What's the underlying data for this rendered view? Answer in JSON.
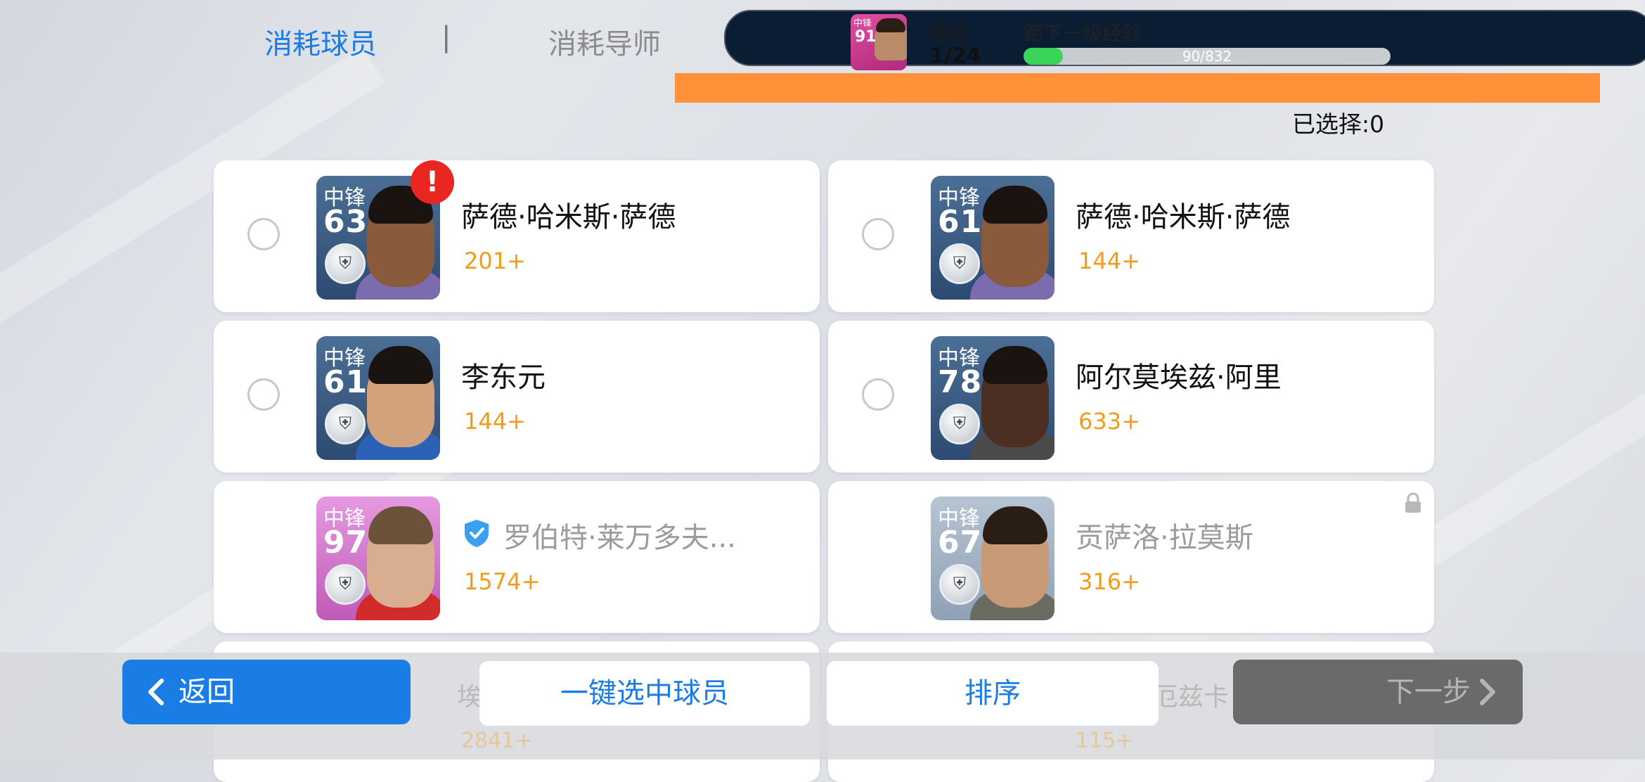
{
  "tabs": {
    "active": "消耗球员",
    "separator": "|",
    "inactive": "消耗导师"
  },
  "level_panel": {
    "card_position": "中锋",
    "card_rating": "91",
    "level_label": "等级",
    "level_value": "1/24",
    "exp_label": "距下一级经验",
    "exp_text": "90/832",
    "exp_progress": 0.108
  },
  "selected_count": "已选择:0",
  "players": [
    {
      "position": "中锋",
      "rating": "63",
      "name": "萨德·哈米斯·萨德",
      "exp": "201+",
      "style": "blue",
      "alert": "!",
      "skin": "#8a5a3c",
      "hair": "#1b1310",
      "shirt": "#7d6bb0",
      "dimmed": false,
      "selectable": true
    },
    {
      "position": "中锋",
      "rating": "61",
      "name": "萨德·哈米斯·萨德",
      "exp": "144+",
      "style": "blue",
      "alert": "",
      "skin": "#8a5a3c",
      "hair": "#1b1310",
      "shirt": "#7d6bb0",
      "dimmed": false,
      "selectable": true
    },
    {
      "position": "中锋",
      "rating": "61",
      "name": "李东元",
      "exp": "144+",
      "style": "blue",
      "alert": "",
      "skin": "#d2a27c",
      "hair": "#1a1410",
      "shirt": "#2b62b8",
      "dimmed": false,
      "selectable": true
    },
    {
      "position": "中锋",
      "rating": "78",
      "name": "阿尔莫埃兹·阿里",
      "exp": "633+",
      "style": "blue",
      "alert": "",
      "skin": "#4a2f22",
      "hair": "#1a1310",
      "shirt": "#4a4a4a",
      "dimmed": false,
      "selectable": true
    },
    {
      "position": "中锋",
      "rating": "97",
      "name": "罗伯特·莱万多夫...",
      "exp": "1574+",
      "style": "pink",
      "alert": "",
      "skin": "#d9ad8f",
      "hair": "#6b5238",
      "shirt": "#d12b2b",
      "dimmed": true,
      "selectable": false,
      "protected": true
    },
    {
      "position": "中锋",
      "rating": "67",
      "name": "贡萨洛·拉莫斯",
      "exp": "316+",
      "style": "grey",
      "alert": "",
      "skin": "#c99a78",
      "hair": "#2a1d14",
      "shirt": "#6b6b62",
      "dimmed": true,
      "selectable": false,
      "locked": true
    }
  ],
  "partial_row": {
    "left_name_fragment": "埃",
    "left_exp": "2841+",
    "right_name_fragment": "厄兹卡",
    "right_exp": "115+"
  },
  "buttons": {
    "back": "返回",
    "auto_select": "一键选中球员",
    "sort": "排序",
    "next": "下一步"
  },
  "colors": {
    "accent_blue": "#1a7de6",
    "exp_orange": "#f39a18",
    "alert_red": "#e9261f",
    "progress_green": "#3ad45a",
    "bar_orange": "#ff9238"
  }
}
